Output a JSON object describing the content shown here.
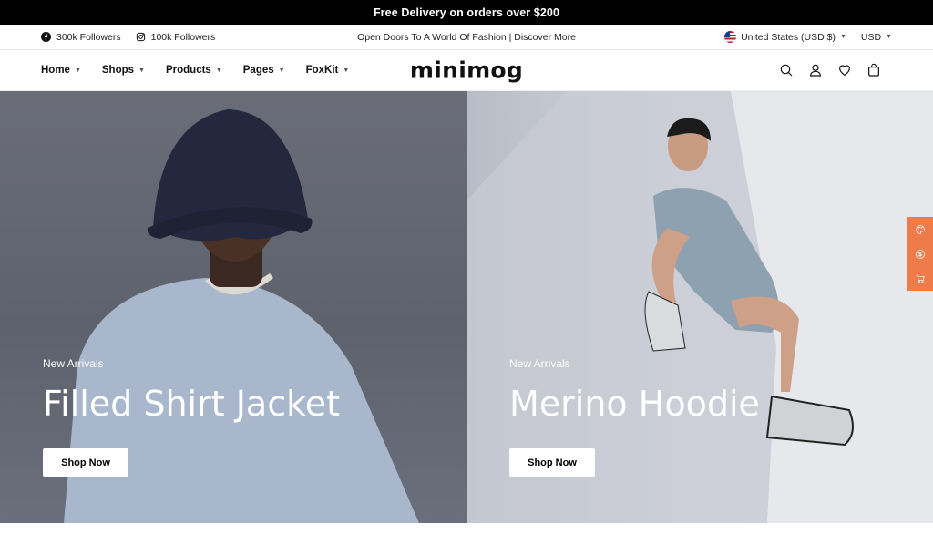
{
  "announcement": "Free Delivery on orders over $200",
  "topbar": {
    "facebook": "300k Followers",
    "instagram": "100k Followers",
    "tagline": "Open Doors To A World Of Fashion | Discover More",
    "country": "United States (USD $)",
    "currency": "USD"
  },
  "nav": {
    "logo": "minimog",
    "menu": [
      "Home",
      "Shops",
      "Products",
      "Pages",
      "FoxKit"
    ]
  },
  "hero": [
    {
      "subtitle": "New Arrivals",
      "title": "Filled Shirt Jacket",
      "button": "Shop Now"
    },
    {
      "subtitle": "New Arrivals",
      "title": "Merino Hoodie",
      "button": "Shop Now"
    }
  ],
  "colors": {
    "accent": "#ef7a4a",
    "announcement_bg": "#000000"
  },
  "icons": [
    "facebook-icon",
    "instagram-icon",
    "us-flag-icon",
    "search-icon",
    "user-icon",
    "heart-icon",
    "bag-icon",
    "palette-icon",
    "dollar-icon",
    "cart-icon"
  ]
}
